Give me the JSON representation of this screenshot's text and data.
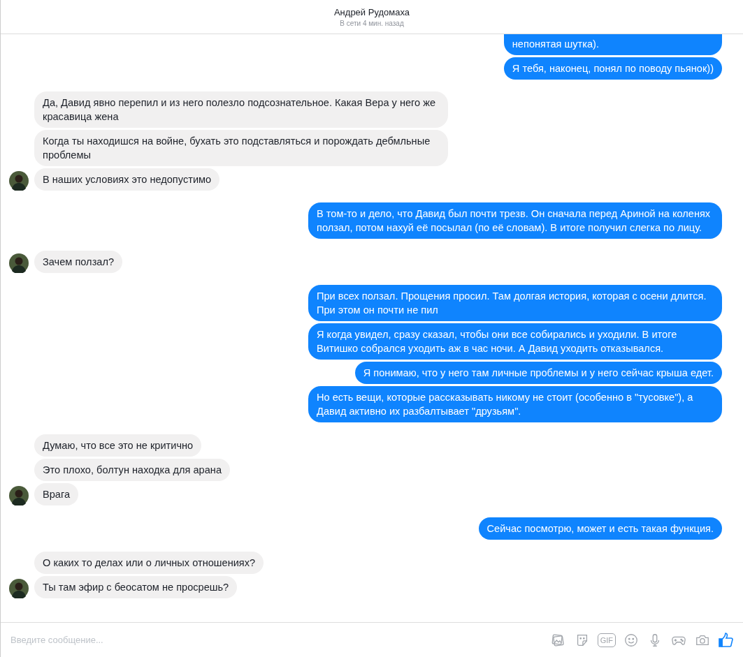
{
  "header": {
    "name": "Андрей Рудомаха",
    "status": "В сети 4 мин. назад"
  },
  "groups": [
    {
      "from_me": true,
      "messages": [
        "непонятая шутка).",
        "Я тебя, наконец, понял по поводу пьянок))"
      ]
    },
    {
      "from_me": false,
      "messages": [
        "Да, Давид явно перепил и из него полезло подсознательное. Какая Вера у него же красавица жена",
        "Когда ты находишся на войне, бухать это подставляться и порождать дебмльные проблемы",
        "В наших условиях это недопустимо"
      ]
    },
    {
      "from_me": true,
      "messages": [
        "В том-то и дело, что Давид был почти трезв. Он сначала перед Ариной на коленях ползал, потом нахуй её посылал (по её словам). В итоге получил слегка по лицу."
      ]
    },
    {
      "from_me": false,
      "messages": [
        "Зачем ползал?"
      ]
    },
    {
      "from_me": true,
      "messages": [
        "При всех ползал. Прощения просил. Там долгая история, которая с осени длится. При этом он почти не пил",
        "Я когда увидел, сразу сказал, чтобы они все собирались и уходили. В итоге Витишко собрался уходить аж в час ночи. А Давид уходить отказывался.",
        "Я понимаю, что у него там личные проблемы и у него сейчас крыша едет.",
        "Но есть вещи, которые рассказывать никому не стоит (особенно в \"тусовке\"), а Давид активно их разбалтывает \"друзьям\"."
      ]
    },
    {
      "from_me": false,
      "messages": [
        "Думаю, что все это не критично",
        "Это плохо, болтун находка для арана",
        "Врага"
      ]
    },
    {
      "from_me": true,
      "messages": [
        "Сейчас посмотрю, может и есть такая функция."
      ]
    },
    {
      "from_me": false,
      "messages": [
        "О каких то делах или о личных отношениях?",
        "Ты там эфир с беосатом не просрешь?"
      ]
    }
  ],
  "composer": {
    "placeholder": "Введите сообщение...",
    "gif_label": "GIF"
  }
}
